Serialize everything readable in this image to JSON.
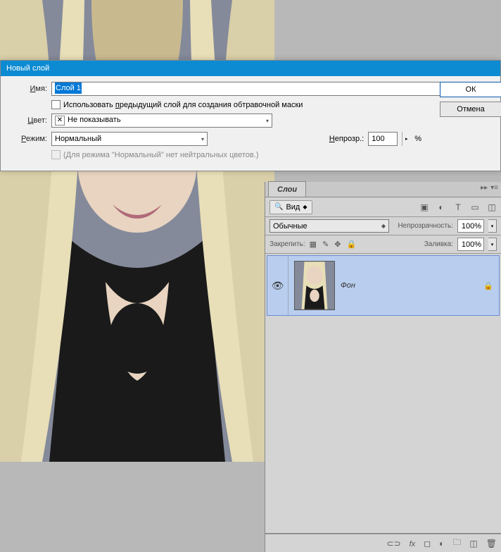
{
  "dialog": {
    "title": "Новый слой",
    "name_label": "Имя:",
    "name_accel": "И",
    "name_value": "Слой 1",
    "use_prev_label": "Использовать предыдущий слой для создания обтравочной маски",
    "use_prev_accel": "п",
    "color_label": "Цвет:",
    "color_accel": "Ц",
    "color_value": "Не показывать",
    "mode_label": "Режим:",
    "mode_accel": "Р",
    "mode_value": "Нормальный",
    "opacity_label": "Непрозр.:",
    "opacity_accel": "Н",
    "opacity_value": "100",
    "opacity_suffix": "%",
    "neutral_label": "(Для режима \"Нормальный\" нет нейтральных цветов.)",
    "ok_label": "ОК",
    "cancel_label": "Отмена"
  },
  "panel": {
    "tab": "Слои",
    "search_kind": "Вид",
    "filter_icons": [
      "image-icon",
      "adjust-icon",
      "type-icon",
      "shape-icon",
      "smart-icon"
    ],
    "blend_mode": "Обычные",
    "opacity_label": "Непрозрачность:",
    "opacity_value": "100%",
    "lock_label": "Закрепить:",
    "fill_label": "Заливка:",
    "fill_value": "100%",
    "layer": {
      "name": "Фон"
    },
    "footer_icons": [
      "link-icon",
      "fx-icon",
      "mask-icon",
      "adjustment-icon",
      "group-icon",
      "new-icon",
      "trash-icon"
    ]
  }
}
